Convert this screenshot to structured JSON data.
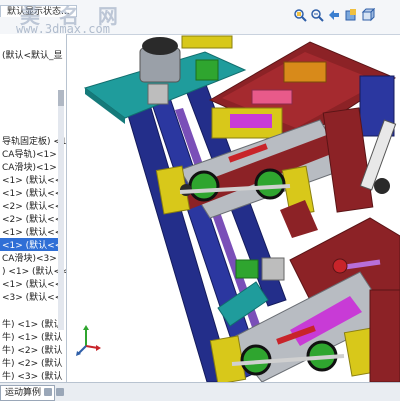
{
  "watermark": {
    "title": "美 名 网",
    "url": "www.3dmax.com"
  },
  "document_tabs": [
    "默认显示状态..."
  ],
  "view_toolbar": {
    "icons": [
      "zoom-to-fit-icon",
      "zoom-area-icon",
      "previous-view-icon",
      "section-view-icon",
      "view-orientation-icon"
    ]
  },
  "feature_tree": {
    "rows": [
      {
        "label": "(默认<默认_显",
        "selected": false
      },
      {
        "label": "导轨固定板) <1",
        "selected": false
      },
      {
        "label": "CA导轨)<1> (",
        "selected": false
      },
      {
        "label": "CA滑块)<1> (",
        "selected": false
      },
      {
        "label": "<1> (默认<<",
        "selected": false
      },
      {
        "label": "<1> (默认<<",
        "selected": false
      },
      {
        "label": "<2> (默认<<",
        "selected": false
      },
      {
        "label": "<2> (默认<<",
        "selected": false
      },
      {
        "label": "<1> (默认<<",
        "selected": false
      },
      {
        "label": "<1> (默认<<",
        "selected": true
      },
      {
        "label": "CA滑块)<3> (",
        "selected": false
      },
      {
        "label": ") <1> (默认<<",
        "selected": false
      },
      {
        "label": "<1> (默认<<",
        "selected": false
      },
      {
        "label": "<3> (默认<<",
        "selected": false
      },
      {
        "label": "牛) <1> (默认",
        "selected": false
      },
      {
        "label": "牛) <1> (默认",
        "selected": false
      },
      {
        "label": "牛) <2> (默认",
        "selected": false
      },
      {
        "label": "牛) <2> (默认",
        "selected": false
      },
      {
        "label": "牛) <3> (默认",
        "selected": false
      }
    ]
  },
  "status_bar": {
    "tab_label": "运动算例 1"
  },
  "colors": {
    "selection": "#2f6fd6",
    "frame_blue": "#232e8a",
    "dark_red": "#8c2226",
    "yellow": "#d8c81a",
    "teal": "#1f9c9c",
    "green": "#2fa52f",
    "magenta": "#c83bd6",
    "grey_rail": "#b8bcc2"
  }
}
